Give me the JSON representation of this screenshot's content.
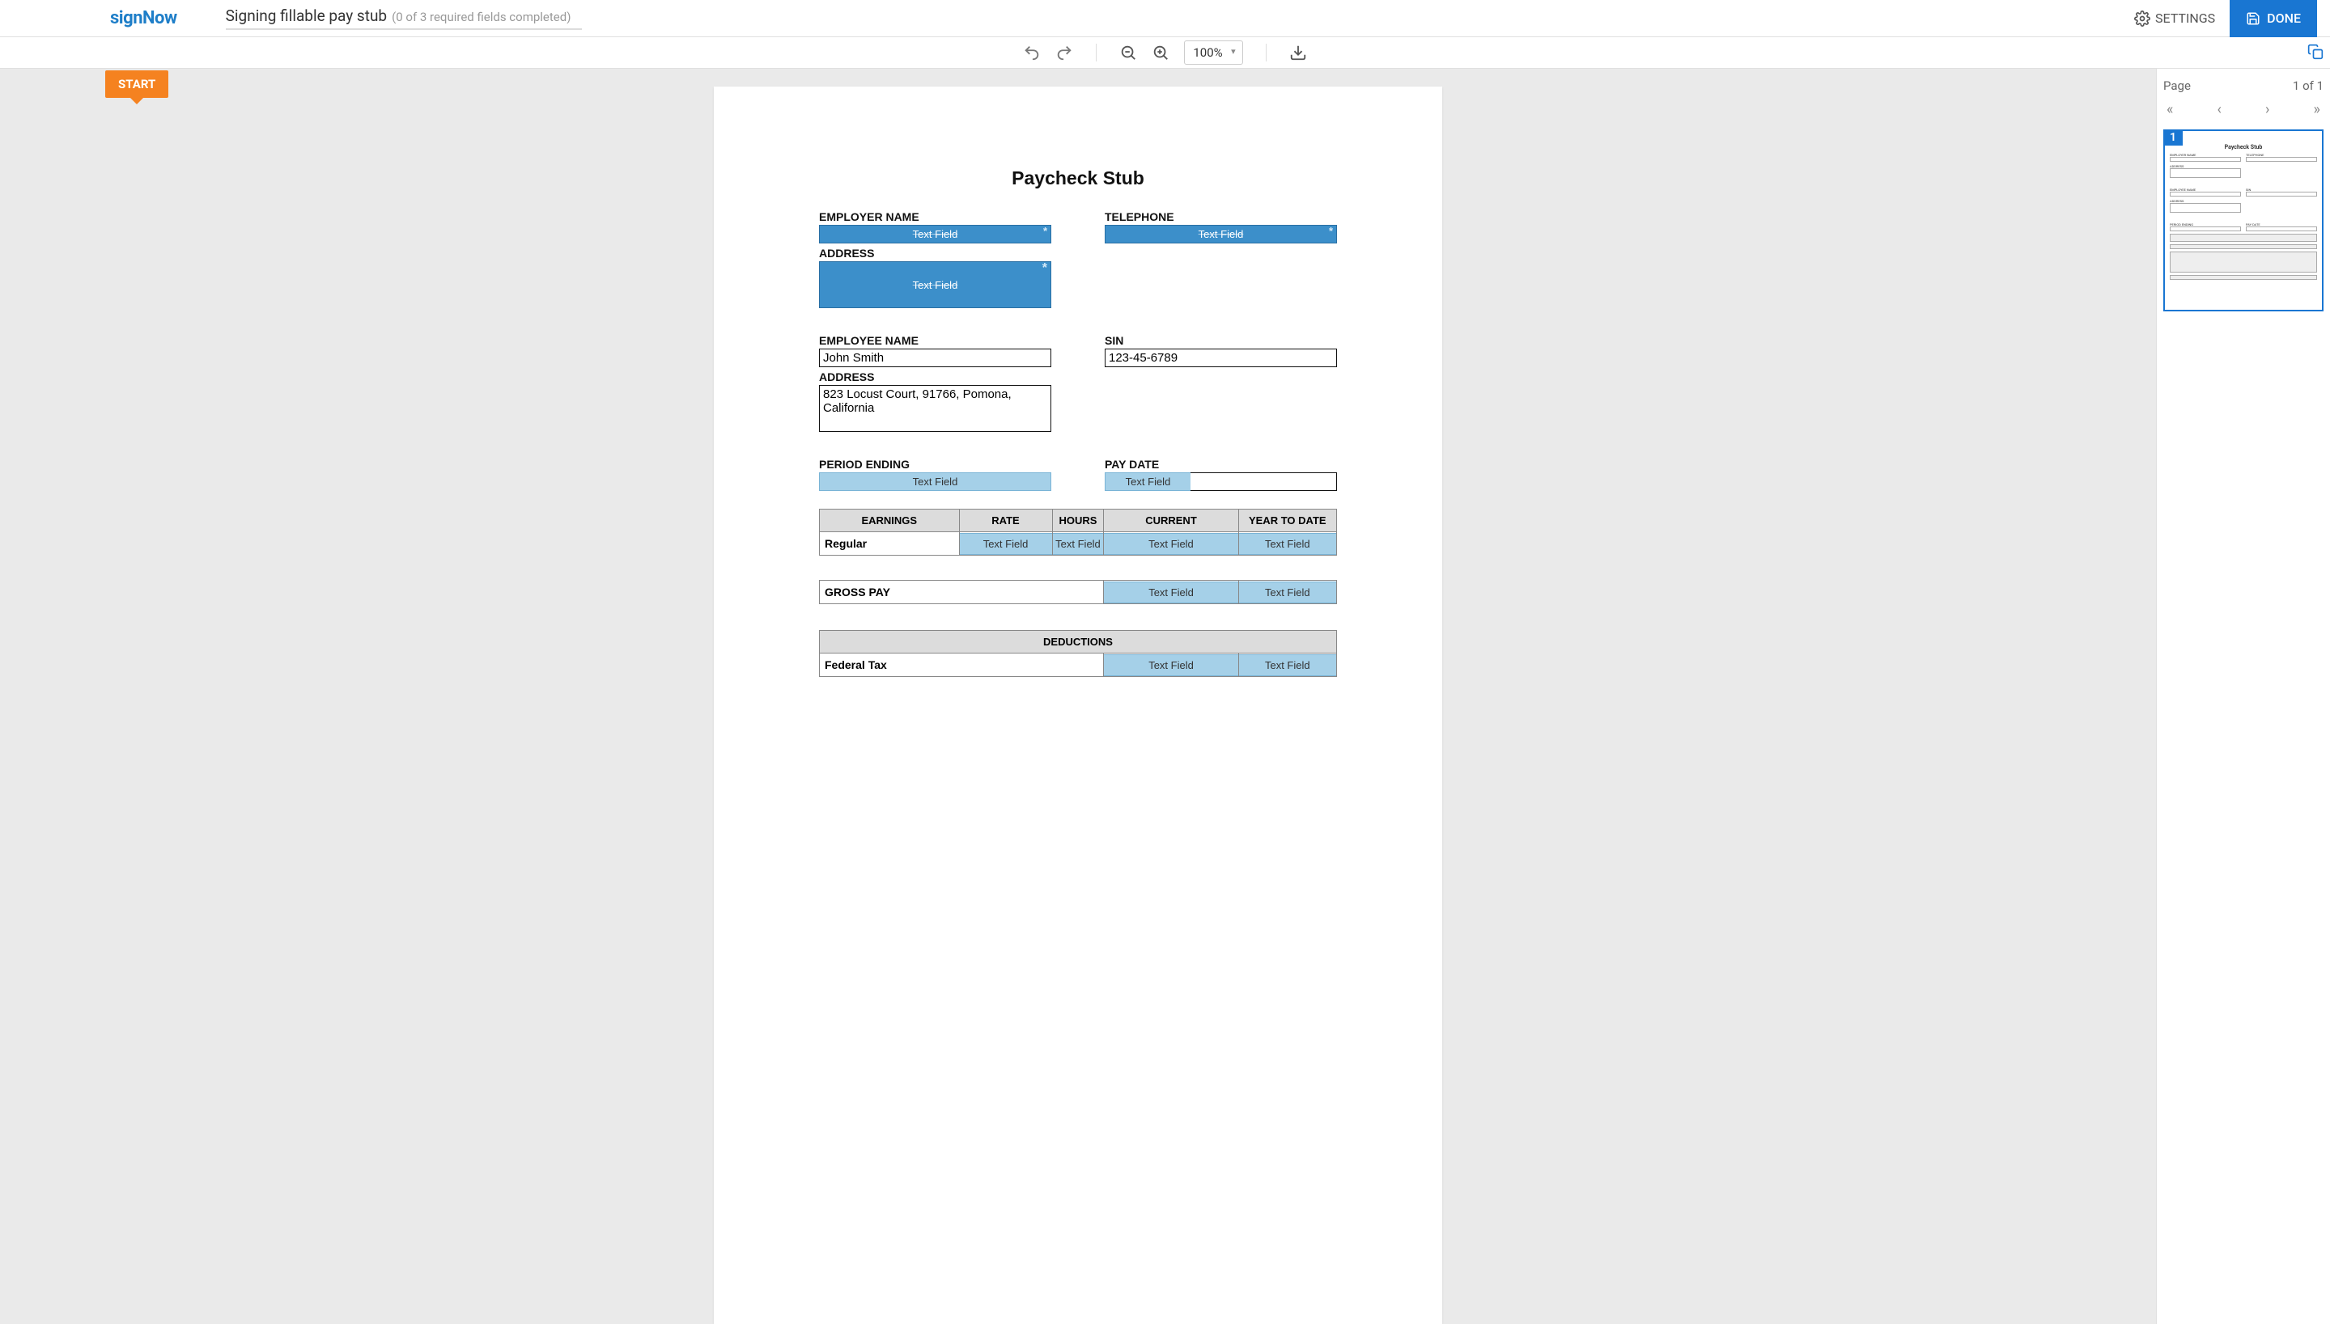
{
  "brand": "signNow",
  "header": {
    "doc_title": "Signing fillable pay stub",
    "status": "(0 of 3 required fields completed)",
    "settings_label": "SETTINGS",
    "done_label": "DONE"
  },
  "toolbar": {
    "zoom": "100%"
  },
  "start_label": "START",
  "doc": {
    "title": "Paycheck Stub",
    "employer_name_label": "EMPLOYER NAME",
    "telephone_label": "TELEPHONE",
    "address_label": "ADDRESS",
    "employee_name_label": "EMPLOYEE NAME",
    "sin_label": "SIN",
    "period_ending_label": "PERIOD ENDING",
    "pay_date_label": "PAY DATE",
    "text_field": "Text Field",
    "employee_name_value": "John Smith",
    "sin_value": "123-45-6789",
    "employee_address_value": "823 Locust Court, 91766, Pomona, California",
    "earnings_headers": {
      "earnings": "EARNINGS",
      "rate": "RATE",
      "hours": "HOURS",
      "current": "CURRENT",
      "ytd": "YEAR TO DATE"
    },
    "earnings_row": "Regular",
    "gross_pay_label": "GROSS PAY",
    "deductions_header": "DEDUCTIONS",
    "deduction_row1": "Federal Tax"
  },
  "sidebar": {
    "page_label": "Page",
    "page_info": "1 of 1",
    "current_page": "1"
  }
}
